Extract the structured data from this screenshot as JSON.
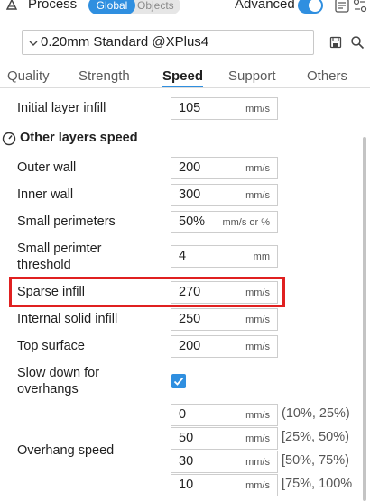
{
  "header": {
    "title": "Process",
    "seg_global": "Global",
    "seg_objects": "Objects",
    "advanced_label": "Advanced",
    "advanced_on": true
  },
  "preset": {
    "name": "0.20mm Standard @XPlus4"
  },
  "tabs": [
    {
      "label": "Quality"
    },
    {
      "label": "Strength"
    },
    {
      "label": "Speed",
      "active": true
    },
    {
      "label": "Support"
    },
    {
      "label": "Others"
    }
  ],
  "settings": {
    "initial_layer_infill": {
      "label": "Initial layer infill",
      "value": "105",
      "unit": "mm/s"
    },
    "section_title": "Other layers speed",
    "outer_wall": {
      "label": "Outer wall",
      "value": "200",
      "unit": "mm/s"
    },
    "inner_wall": {
      "label": "Inner wall",
      "value": "300",
      "unit": "mm/s"
    },
    "small_perimeters": {
      "label": "Small perimeters",
      "value": "50%",
      "unit": "mm/s or %"
    },
    "small_perimeter_threshold": {
      "label_line1": "Small perimter",
      "label_line2": "threshold",
      "value": "4",
      "unit": "mm"
    },
    "sparse_infill": {
      "label": "Sparse infill",
      "value": "270",
      "unit": "mm/s"
    },
    "internal_solid_infill": {
      "label": "Internal solid infill",
      "value": "250",
      "unit": "mm/s"
    },
    "top_surface": {
      "label": "Top surface",
      "value": "200",
      "unit": "mm/s"
    },
    "slow_down_overhangs": {
      "label_line1": "Slow down for",
      "label_line2": "overhangs",
      "checked": true
    },
    "overhang_speed": {
      "label": "Overhang speed",
      "rows": [
        {
          "value": "0",
          "unit": "mm/s",
          "range": "(10%, 25%)"
        },
        {
          "value": "50",
          "unit": "mm/s",
          "range": "[25%, 50%)"
        },
        {
          "value": "30",
          "unit": "mm/s",
          "range": "[50%, 75%)"
        },
        {
          "value": "10",
          "unit": "mm/s",
          "range": "[75%, 100%"
        }
      ]
    }
  },
  "colors": {
    "accent": "#2f8fe0",
    "highlight": "#e02020"
  },
  "icons": {
    "process": "process-icon",
    "settings_toggle": "list-settings-icon",
    "compare": "compare-icon",
    "save": "save-icon",
    "search": "search-icon",
    "section": "gauge-icon",
    "chevron": "chevron-down-icon",
    "check": "check-icon"
  }
}
